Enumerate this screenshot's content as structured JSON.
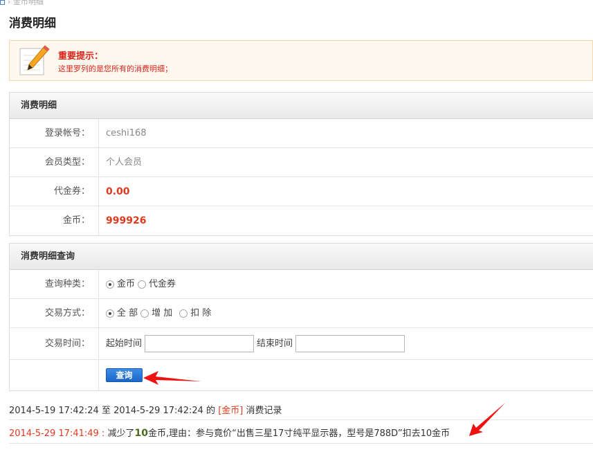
{
  "breadcrumb": {
    "text": "› 金币明细"
  },
  "page_title": "消费明细",
  "notice": {
    "title": "重要提示：",
    "text": "这里罗列的是您所有的消费明细；"
  },
  "account_panel": {
    "header": "消费明细",
    "rows": [
      {
        "label": "登录帐号：",
        "value": "ceshi168"
      },
      {
        "label": "会员类型：",
        "value": "个人会员"
      },
      {
        "label": "代金券：",
        "value": "0.00"
      },
      {
        "label": "金币：",
        "value": "999926"
      }
    ]
  },
  "query_panel": {
    "header": "消费明细查询",
    "type_label": "查询种类：",
    "type_options": [
      {
        "label": "金币",
        "checked": true
      },
      {
        "label": "代金券",
        "checked": false
      }
    ],
    "mode_label": "交易方式：",
    "mode_options": [
      {
        "label": "全 部",
        "checked": true
      },
      {
        "label": "增 加",
        "checked": false
      },
      {
        "label": "扣 除",
        "checked": false
      }
    ],
    "time_label": "交易时间：",
    "start_label": "起始时间",
    "start_value": "",
    "end_label": "结束时间",
    "end_value": "",
    "submit_label": "查询"
  },
  "summary": {
    "start": "2014-5-19 17:42:24",
    "to": "至",
    "end": "2014-5-29 17:42:24",
    "of": "的",
    "currency": "[金币]",
    "suffix": "消费记录"
  },
  "records": [
    {
      "date": "2014-5-29 17:41:49 :",
      "prefix": "减少了",
      "amount": "10",
      "text": "金币,理由：参与竟价“出售三星17寸纯平显示器，型号是788D”扣去10金币"
    }
  ],
  "colors": {
    "accent_red": "#e03a1e",
    "button_blue": "#1a66c7",
    "notice_bg": "#fff8ef"
  }
}
